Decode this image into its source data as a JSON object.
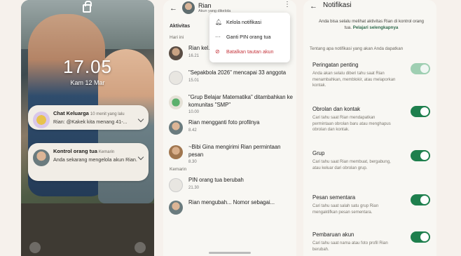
{
  "lockscreen": {
    "time": "17.05",
    "date": "Kam 12 Mar",
    "notifications": [
      {
        "title": "Chat Keluarga",
        "meta": "10 menit yang lalu",
        "body": "Rian: @Kakek kita menang 41-..."
      },
      {
        "title": "Kontrol orang tua",
        "meta": "Kemarin",
        "body": "Anda sekarang mengelola akun Rian."
      }
    ]
  },
  "activity": {
    "header": {
      "name": "Rian",
      "subtitle": "Akun yang dikelola"
    },
    "section_title": "Aktivitas",
    "today_label": "Hari ini",
    "yesterday_label": "Kemarin",
    "items": [
      {
        "text": "Rian kel... Januari",
        "time": "16.21"
      },
      {
        "text": "\"Sepakbola 2026\" mencapai 33 anggota",
        "time": "15.01"
      },
      {
        "text": "\"Grup Belajar Matematika\" ditambahkan ke komunitas \"SMP\"",
        "time": "10.00"
      },
      {
        "text": "Rian mengganti foto profilnya",
        "time": "8.42"
      },
      {
        "text": "~Bibi Gina mengirimi Rian permintaan pesan",
        "time": "8.30"
      },
      {
        "text": "PIN orang tua berubah",
        "time": "21.30"
      },
      {
        "text": "Rian mengubah... Nomor sebagai...",
        "time": ""
      }
    ],
    "menu": [
      {
        "label": "Kelola notifikasi",
        "icon": "bell-icon"
      },
      {
        "label": "Ganti PIN orang tua",
        "icon": "dots-icon"
      },
      {
        "label": "Batalkan tautan akun",
        "icon": "unlink-icon"
      }
    ]
  },
  "notif_settings": {
    "title": "Notifikasi",
    "intro": "Anda bisa selalu melihat aktivitas Rian di kontrol orang tua.",
    "intro_link": "Pelajari selengkapnya",
    "question": "Tentang apa notifikasi yang akan Anda dapatkan",
    "settings": [
      {
        "title": "Peringatan penting",
        "desc": "Anda akan selalu diberi tahu saat Rian menambahkan, memblokir, atau melaporkan kontak.",
        "on": true,
        "disabled": true
      },
      {
        "title": "Obrolan dan kontak",
        "desc": "Cari tahu saat Rian mendapatkan permintaan obrolan baru atau menghapus obrolan dan kontak.",
        "on": true,
        "disabled": false
      },
      {
        "title": "Grup",
        "desc": "Cari tahu saat Rian membuat, bergabung, atau keluar dari obrolan grup.",
        "on": true,
        "disabled": false
      },
      {
        "title": "Pesan sementara",
        "desc": "Cari tahu saat salah satu grup Rian mengaktifkan pesan sementara.",
        "on": true,
        "disabled": false
      },
      {
        "title": "Pembaruan akun",
        "desc": "Cari tahu saat nama atau foto profil Rian berubah.",
        "on": true,
        "disabled": false
      }
    ]
  }
}
